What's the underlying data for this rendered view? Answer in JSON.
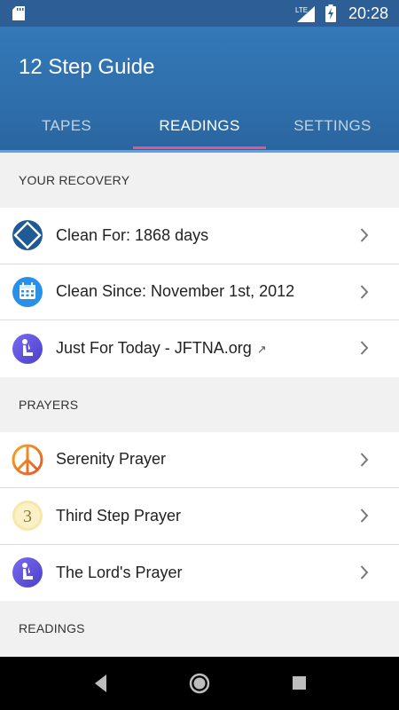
{
  "status_bar": {
    "network": "LTE",
    "time": "20:28",
    "icons": [
      "sd-card-icon",
      "signal-icon",
      "battery-charging-icon"
    ]
  },
  "app_bar": {
    "title": "12 Step Guide",
    "tabs": [
      {
        "label": "TAPES",
        "active": false
      },
      {
        "label": "READINGS",
        "active": true
      },
      {
        "label": "SETTINGS",
        "active": false
      }
    ]
  },
  "sections": {
    "recovery": {
      "header": "YOUR RECOVERY",
      "items": [
        {
          "label": "Clean For: 1868 days",
          "icon": "na-diamond-icon"
        },
        {
          "label": "Clean Since: November 1st, 2012",
          "icon": "calendar-icon"
        },
        {
          "label": "Just For Today - JFTNA.org",
          "external": "↗",
          "icon": "praying-person-icon"
        }
      ]
    },
    "prayers": {
      "header": "PRAYERS",
      "items": [
        {
          "label": "Serenity Prayer",
          "icon": "peace-sign-icon"
        },
        {
          "label": "Third Step Prayer",
          "icon": "number-three-icon"
        },
        {
          "label": "The Lord's Prayer",
          "icon": "praying-person-icon"
        }
      ]
    },
    "readings": {
      "header": "READINGS"
    }
  },
  "nav_bar": {
    "buttons": [
      "back-icon",
      "home-icon",
      "recents-icon"
    ]
  },
  "colors": {
    "app_bar": "#2e6fab",
    "tab_indicator": "#e8548a",
    "status_bar": "#2d5f96"
  }
}
